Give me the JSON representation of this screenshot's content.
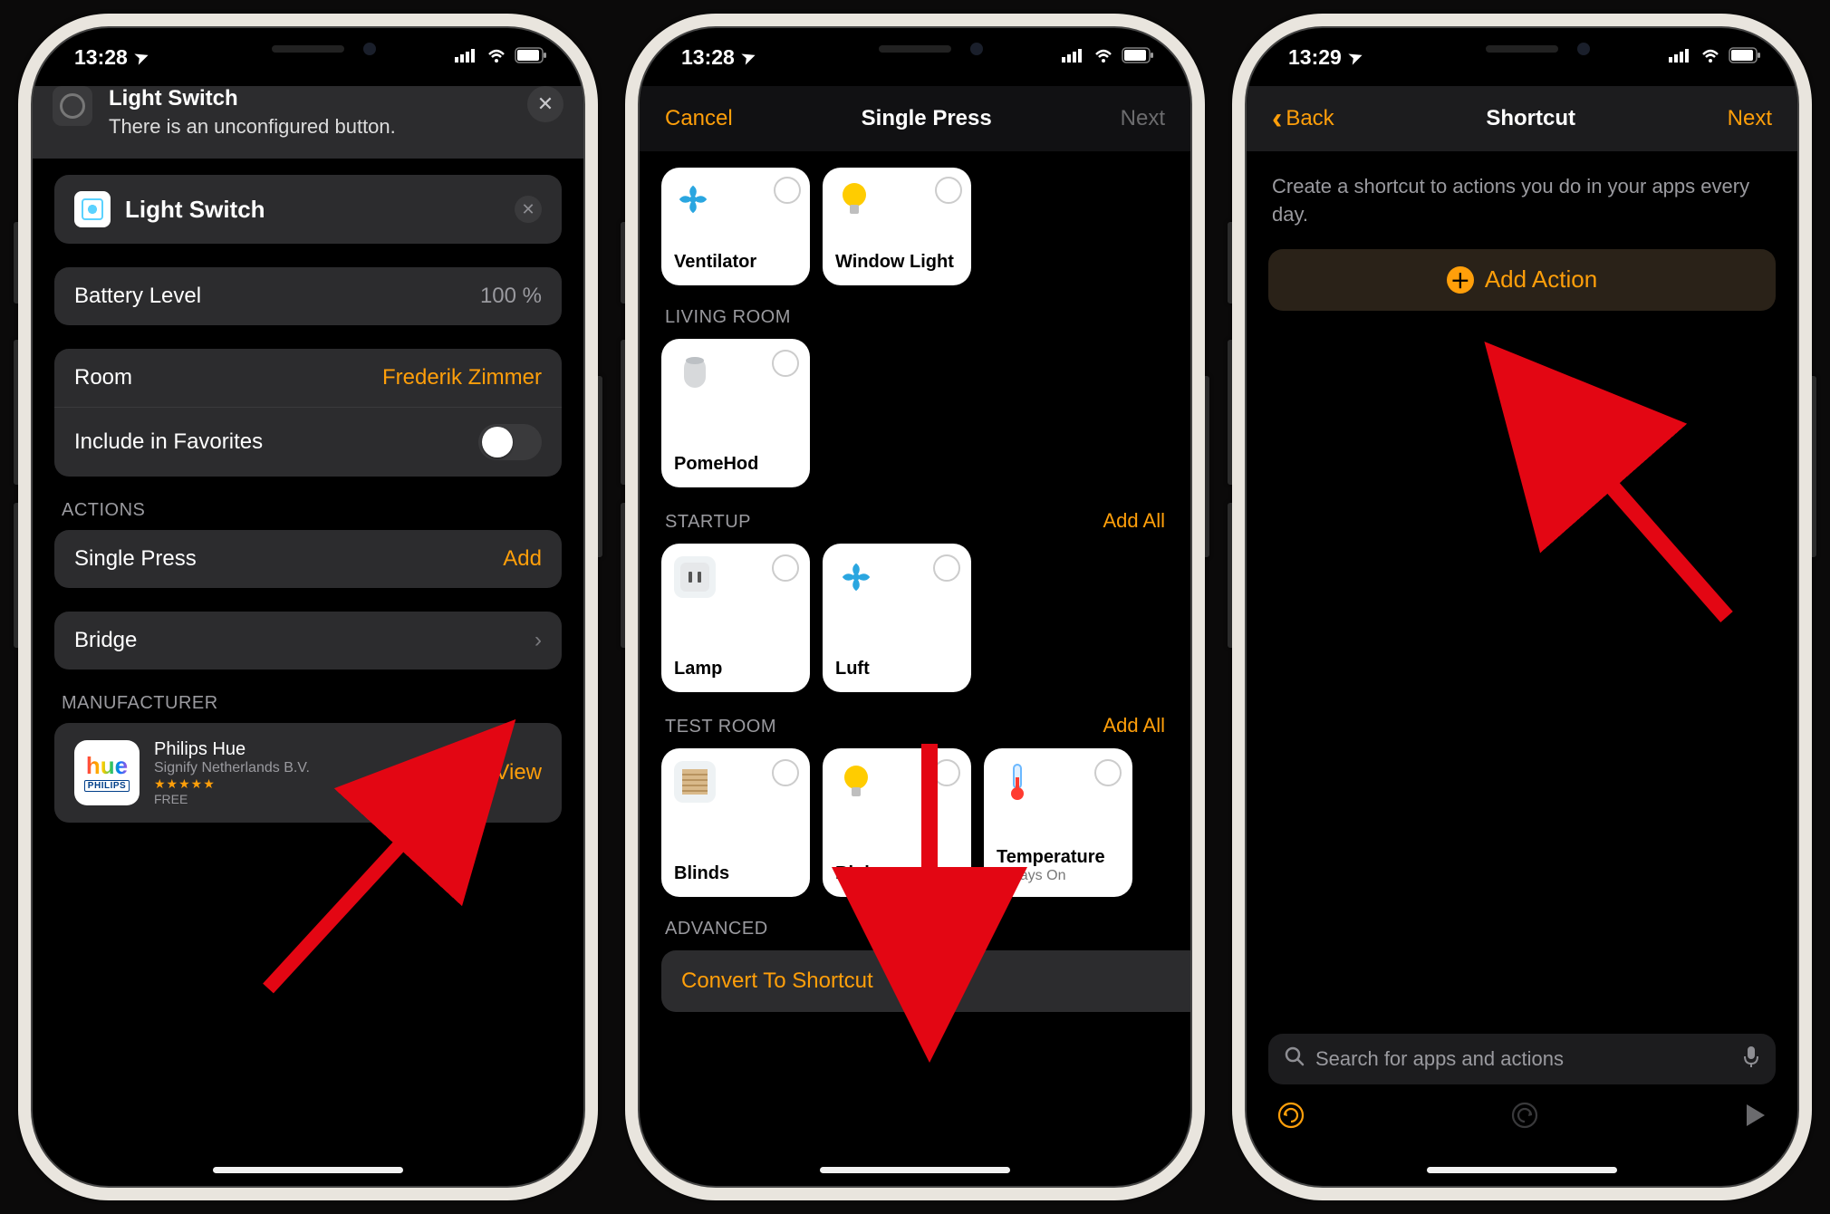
{
  "screens": {
    "s1": {
      "time": "13:28",
      "header": {
        "title": "Light Switch",
        "subtitle": "There is an unconfigured button."
      },
      "accessory": {
        "name": "Light Switch"
      },
      "battery": {
        "label": "Battery Level",
        "value": "100 %"
      },
      "room": {
        "label": "Room",
        "value": "Frederik Zimmer"
      },
      "favorites_label": "Include in Favorites",
      "actions_section": "ACTIONS",
      "single_press": {
        "label": "Single Press",
        "action": "Add"
      },
      "bridge": "Bridge",
      "manufacturer_section": "MANUFACTURER",
      "hue": {
        "name": "Philips Hue",
        "company": "Signify Netherlands B.V.",
        "price": "FREE",
        "view": "View"
      }
    },
    "s2": {
      "time": "13:28",
      "nav": {
        "left": "Cancel",
        "title": "Single Press",
        "right": "Next"
      },
      "top_tiles": {
        "ventilator": "Ventilator",
        "window_light": "Window Light"
      },
      "living": {
        "title": "LIVING ROOM",
        "pomehod": "PomeHod"
      },
      "startup": {
        "title": "STARTUP",
        "addall": "Add All",
        "lamp": "Lamp",
        "luft": "Luft"
      },
      "testroom": {
        "title": "TEST ROOM",
        "addall": "Add All",
        "blinds": "Blinds",
        "blub": "Blub group",
        "temp": "Temperature",
        "temp_sub": "Always On"
      },
      "advanced_section": "ADVANCED",
      "convert": "Convert To Shortcut"
    },
    "s3": {
      "time": "13:29",
      "nav": {
        "back": "Back",
        "title": "Shortcut",
        "right": "Next"
      },
      "desc": "Create a shortcut to actions you do in your apps every day.",
      "add_action": "Add Action",
      "search_placeholder": "Search for apps and actions"
    }
  },
  "icons": {
    "location": "➤",
    "signal": "▮▮▮▮",
    "wifi": "ᯤ",
    "battery": "▭",
    "close": "✕",
    "chevron": "›",
    "back": "‹",
    "search": "🔍",
    "mic": "🎤",
    "undo": "↺",
    "redo": "↻",
    "play": "▶"
  }
}
